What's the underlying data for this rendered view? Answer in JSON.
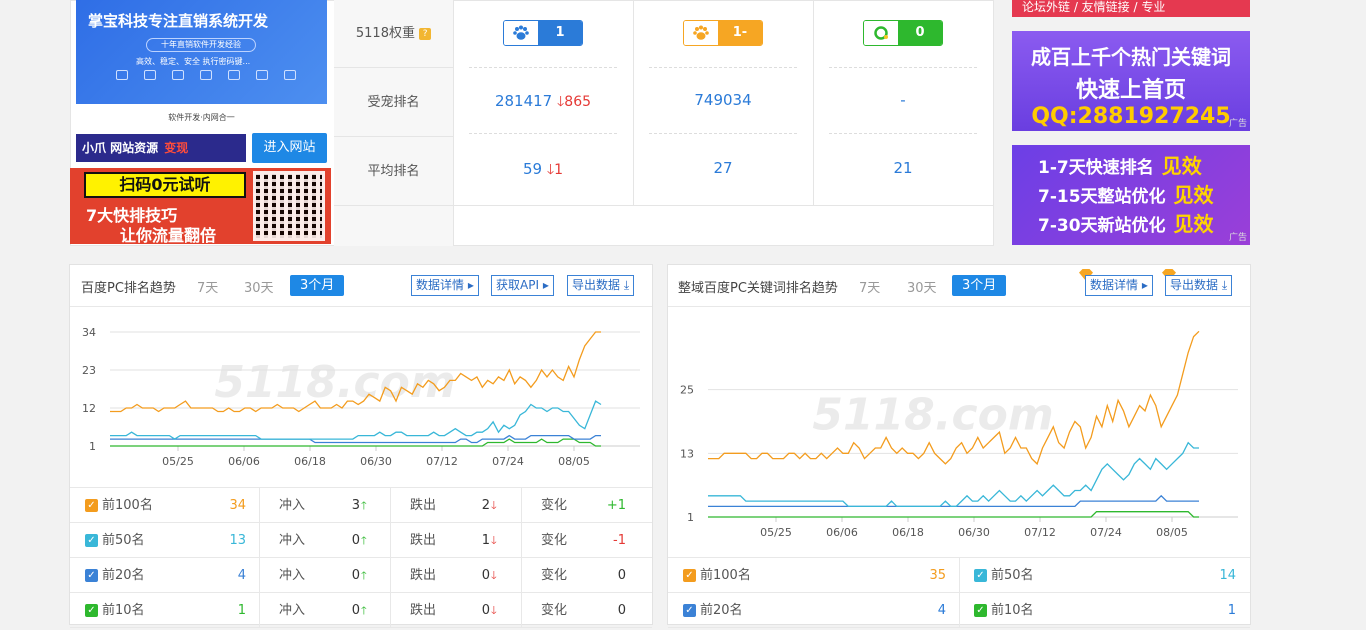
{
  "left_ads": {
    "ad1_title": "掌宝科技专注直销系统开发",
    "ad1_pill": "十年直销软件开发经验",
    "ad1_sub": "高效、稳定、安全  执行密码键...",
    "ad1_caption": "软件开发·内网合一",
    "ad2_text": "小爪  网站资源",
    "ad2_hi": "变现",
    "enter_button": "进入网站",
    "ad3_yellow": "扫码0元试听",
    "ad3_line1": "7大快排技巧",
    "ad3_line2": "让你流量翻倍"
  },
  "rank_table": {
    "labels": [
      "5118权重",
      "受宠排名",
      "平均排名"
    ],
    "badges": [
      {
        "value": "1",
        "color": "#2b7bd8",
        "icon": "baidu-paw-icon"
      },
      {
        "value": "1-",
        "color": "#f6a623",
        "icon": "mobile-paw-icon"
      },
      {
        "value": "0",
        "color": "#2eb82e",
        "icon": "so360-icon"
      }
    ],
    "rank_row": [
      {
        "value": "281417",
        "delta": "865"
      },
      {
        "value": "749034",
        "delta": ""
      },
      {
        "value": "-",
        "delta": ""
      }
    ],
    "avg_row": [
      {
        "value": "59",
        "delta": "1"
      },
      {
        "value": "27",
        "delta": ""
      },
      {
        "value": "21",
        "delta": ""
      }
    ]
  },
  "right_ads": {
    "rad1": "论坛外链 / 友情链接 / 专业",
    "rad2_line1": "成百上千个热门关键词",
    "rad2_line2": "快速上首页",
    "rad2_line3": "QQ:2881927245",
    "rad3_lines": [
      {
        "text": "1-7天快速排名",
        "hi": "见效"
      },
      {
        "text": "7-15天整站优化",
        "hi": "见效"
      },
      {
        "text": "7-30天新站优化",
        "hi": "见效"
      }
    ],
    "ad_tag": "广告"
  },
  "panel_left": {
    "title": "百度PC排名趋势",
    "tabs": [
      "7天",
      "30天",
      "3个月"
    ],
    "buttons": [
      "数据详情",
      "获取API",
      "导出数据"
    ],
    "rows": [
      {
        "label": "前100名",
        "count": "34",
        "check_color": "#f39c1e",
        "in_label": "冲入",
        "in": "3",
        "out_label": "跌出",
        "out": "2",
        "chg_label": "变化",
        "chg": "+1",
        "chg_color": "#2eb82e"
      },
      {
        "label": "前50名",
        "count": "13",
        "check_color": "#39b7d8",
        "in_label": "冲入",
        "in": "0",
        "out_label": "跌出",
        "out": "1",
        "chg_label": "变化",
        "chg": "-1",
        "chg_color": "#e53935"
      },
      {
        "label": "前20名",
        "count": "4",
        "check_color": "#3b82d6",
        "in_label": "冲入",
        "in": "0",
        "out_label": "跌出",
        "out": "0",
        "chg_label": "变化",
        "chg": "0",
        "chg_color": "#333"
      },
      {
        "label": "前10名",
        "count": "1",
        "check_color": "#2eb82e",
        "in_label": "冲入",
        "in": "0",
        "out_label": "跌出",
        "out": "0",
        "chg_label": "变化",
        "chg": "0",
        "chg_color": "#333"
      }
    ]
  },
  "panel_right": {
    "title": "整域百度PC关键词排名趋势",
    "tabs": [
      "7天",
      "30天",
      "3个月"
    ],
    "buttons": [
      "数据详情",
      "导出数据"
    ],
    "legend": [
      {
        "label": "前100名",
        "count": "35",
        "check_color": "#f39c1e"
      },
      {
        "label": "前50名",
        "count": "14",
        "check_color": "#39b7d8"
      },
      {
        "label": "前20名",
        "count": "4",
        "check_color": "#3b82d6"
      },
      {
        "label": "前10名",
        "count": "1",
        "check_color": "#2eb82e"
      }
    ]
  },
  "watermark": "5118.com",
  "chart_data": [
    {
      "type": "line",
      "x_ticks": [
        "05/25",
        "06/06",
        "06/18",
        "06/30",
        "07/12",
        "07/24",
        "08/05"
      ],
      "y_ticks": [
        1,
        12,
        23,
        34
      ],
      "ylim": [
        1,
        34
      ],
      "series": [
        {
          "name": "前100名",
          "color": "#f39c1e",
          "values": [
            11,
            11,
            11,
            12,
            12,
            13,
            12,
            12,
            12,
            11,
            12,
            12,
            12,
            13,
            14,
            12,
            12,
            12,
            12,
            12,
            11,
            11,
            12,
            11,
            11,
            12,
            12,
            11,
            12,
            12,
            12,
            13,
            12,
            12,
            12,
            11,
            12,
            13,
            14,
            12,
            12,
            12,
            13,
            12,
            14,
            14,
            13,
            14,
            16,
            15,
            14,
            18,
            17,
            14,
            18,
            17,
            16,
            19,
            18,
            20,
            19,
            17,
            18,
            20,
            20,
            22,
            21,
            20,
            21,
            18,
            20,
            19,
            21,
            20,
            23,
            19,
            21,
            20,
            18,
            20,
            23,
            21,
            23,
            21,
            20,
            24,
            21,
            26,
            30,
            32,
            34,
            34
          ]
        },
        {
          "name": "前50名",
          "color": "#39b7d8",
          "values": [
            4,
            4,
            4,
            4,
            5,
            4,
            4,
            4,
            4,
            4,
            4,
            4,
            3,
            4,
            4,
            4,
            4,
            4,
            4,
            4,
            4,
            4,
            4,
            4,
            4,
            4,
            4,
            4,
            3,
            3,
            3,
            3,
            3,
            3,
            3,
            3,
            3,
            3,
            3,
            3,
            3,
            3,
            3,
            3,
            3,
            3,
            4,
            4,
            4,
            4,
            5,
            4,
            4,
            5,
            5,
            4,
            4,
            4,
            4,
            4,
            5,
            4,
            4,
            5,
            6,
            5,
            4,
            4,
            5,
            5,
            6,
            8,
            5,
            7,
            6,
            7,
            10,
            11,
            13,
            12,
            12,
            11,
            12,
            12,
            11,
            11,
            9,
            7,
            6,
            10,
            14,
            13
          ]
        },
        {
          "name": "前20名",
          "color": "#3b82d6",
          "values": [
            3,
            3,
            3,
            3,
            3,
            3,
            3,
            3,
            3,
            3,
            3,
            3,
            3,
            3,
            3,
            3,
            3,
            3,
            3,
            3,
            3,
            3,
            3,
            3,
            3,
            3,
            3,
            3,
            3,
            3,
            3,
            3,
            3,
            3,
            3,
            3,
            3,
            3,
            2,
            2,
            2,
            2,
            2,
            2,
            2,
            2,
            2,
            2,
            2,
            2,
            2,
            2,
            2,
            2,
            2,
            2,
            2,
            2,
            2,
            2,
            2,
            2,
            2,
            2,
            2,
            3,
            3,
            2,
            2,
            3,
            3,
            3,
            3,
            3,
            4,
            3,
            3,
            3,
            4,
            4,
            4,
            4,
            4,
            4,
            4,
            4,
            3,
            3,
            3,
            3,
            4,
            4
          ]
        },
        {
          "name": "前10名",
          "color": "#2eb82e",
          "values": [
            1,
            1,
            1,
            1,
            1,
            1,
            1,
            1,
            1,
            1,
            1,
            1,
            1,
            1,
            1,
            1,
            1,
            1,
            1,
            1,
            1,
            1,
            1,
            1,
            1,
            1,
            1,
            1,
            1,
            1,
            1,
            1,
            1,
            1,
            1,
            1,
            1,
            1,
            1,
            1,
            1,
            1,
            1,
            1,
            1,
            1,
            1,
            1,
            1,
            1,
            1,
            1,
            1,
            1,
            1,
            1,
            1,
            1,
            1,
            1,
            1,
            1,
            1,
            1,
            1,
            1,
            1,
            1,
            1,
            1,
            2,
            2,
            2,
            2,
            3,
            2,
            2,
            2,
            2,
            2,
            3,
            2,
            2,
            2,
            3,
            3,
            3,
            2,
            2,
            2,
            1,
            1
          ]
        }
      ]
    },
    {
      "type": "line",
      "x_ticks": [
        "05/25",
        "06/06",
        "06/18",
        "06/30",
        "07/12",
        "07/24",
        "08/05"
      ],
      "y_ticks": [
        1,
        13,
        25
      ],
      "ylim": [
        1,
        37
      ],
      "series": [
        {
          "name": "前100名",
          "color": "#f39c1e",
          "values": [
            12,
            12,
            12,
            13,
            13,
            13,
            13,
            13,
            12,
            12,
            13,
            13,
            12,
            12,
            12,
            13,
            13,
            12,
            13,
            12,
            12,
            13,
            12,
            13,
            14,
            13,
            13,
            15,
            14,
            12,
            13,
            14,
            14,
            16,
            14,
            13,
            14,
            13,
            13,
            12,
            13,
            15,
            13,
            12,
            11,
            12,
            14,
            15,
            13,
            14,
            16,
            14,
            15,
            16,
            17,
            13,
            14,
            16,
            14,
            14,
            12,
            11,
            14,
            16,
            18,
            15,
            14,
            17,
            19,
            18,
            14,
            16,
            20,
            18,
            22,
            19,
            23,
            21,
            18,
            20,
            22,
            21,
            24,
            22,
            18,
            20,
            22,
            24,
            28,
            32,
            35,
            36
          ]
        },
        {
          "name": "前50名",
          "color": "#39b7d8",
          "values": [
            5,
            5,
            5,
            5,
            5,
            5,
            5,
            4,
            4,
            4,
            4,
            4,
            4,
            4,
            4,
            4,
            4,
            4,
            4,
            4,
            4,
            4,
            4,
            4,
            4,
            4,
            3,
            3,
            3,
            3,
            3,
            3,
            3,
            3,
            4,
            3,
            3,
            3,
            3,
            3,
            3,
            3,
            3,
            3,
            4,
            3,
            3,
            4,
            5,
            4,
            4,
            5,
            4,
            5,
            6,
            5,
            4,
            4,
            5,
            4,
            5,
            6,
            5,
            6,
            7,
            6,
            5,
            5,
            6,
            6,
            7,
            6,
            8,
            10,
            11,
            10,
            9,
            8,
            9,
            11,
            12,
            11,
            10,
            12,
            11,
            10,
            11,
            12,
            13,
            15,
            14,
            14
          ]
        },
        {
          "name": "前20名",
          "color": "#3b82d6",
          "values": [
            3,
            3,
            3,
            3,
            3,
            3,
            3,
            3,
            3,
            3,
            3,
            3,
            3,
            3,
            3,
            3,
            3,
            3,
            3,
            3,
            3,
            3,
            3,
            3,
            3,
            3,
            3,
            3,
            3,
            3,
            3,
            3,
            3,
            3,
            3,
            3,
            3,
            3,
            3,
            3,
            3,
            3,
            3,
            3,
            3,
            3,
            3,
            3,
            3,
            3,
            3,
            3,
            3,
            3,
            3,
            3,
            3,
            3,
            3,
            3,
            3,
            3,
            3,
            3,
            3,
            3,
            3,
            3,
            3,
            4,
            4,
            4,
            4,
            4,
            4,
            4,
            4,
            4,
            4,
            4,
            4,
            4,
            4,
            4,
            5,
            4,
            4,
            4,
            4,
            4,
            4,
            4
          ]
        },
        {
          "name": "前10名",
          "color": "#2eb82e",
          "values": [
            1,
            1,
            1,
            1,
            1,
            1,
            1,
            1,
            1,
            1,
            1,
            1,
            1,
            1,
            1,
            1,
            1,
            1,
            1,
            1,
            1,
            1,
            1,
            1,
            1,
            1,
            1,
            1,
            1,
            1,
            1,
            1,
            1,
            1,
            1,
            1,
            1,
            1,
            1,
            1,
            1,
            1,
            1,
            1,
            1,
            1,
            1,
            1,
            1,
            1,
            1,
            1,
            1,
            1,
            1,
            1,
            1,
            1,
            1,
            1,
            1,
            1,
            1,
            1,
            1,
            1,
            1,
            1,
            1,
            1,
            1,
            1,
            2,
            2,
            2,
            2,
            2,
            2,
            2,
            2,
            2,
            2,
            2,
            2,
            2,
            2,
            2,
            2,
            2,
            2,
            1,
            1
          ]
        }
      ]
    }
  ]
}
